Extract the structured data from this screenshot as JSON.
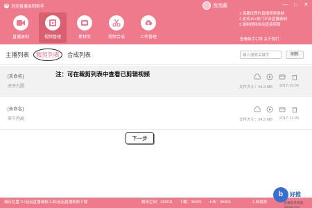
{
  "app": {
    "title": "泡泡直播录制助手",
    "logo_glyph": "B",
    "brand_color": "#ee7a8c"
  },
  "user": {
    "name": "泡泡酱"
  },
  "window_controls": [
    "—",
    "□",
    "✕"
  ],
  "toolbar": [
    {
      "label": "直播录制",
      "icon": "video-camera-icon"
    },
    {
      "label": "视频管理",
      "icon": "film-icon",
      "active": true
    },
    {
      "label": "素材库",
      "icon": "library-icon"
    },
    {
      "label": "视频合成",
      "icon": "scissors-icon"
    },
    {
      "label": "上传管理",
      "icon": "upload-icon"
    }
  ],
  "tips": [
    "1.海量优质的直播视频录制",
    "2.支持15+热门平台直播录制",
    "3.录制视频自动直接剪辑"
  ],
  "help": {
    "guide": "查看新手引导",
    "about": "关于我们"
  },
  "subtabs": [
    "主播列表",
    "裁剪列表",
    "合成列表"
  ],
  "search": {
    "placeholder": "输入搜索关键字",
    "button": "刷新"
  },
  "rows": [
    {
      "name": "[未命名]",
      "sub": "虎牙九圆",
      "size": "文件大小：54.3 MB",
      "date": "2017-12-05"
    },
    {
      "name": "[未命名]",
      "sub": "某牛狗高",
      "size": "文件大小：94.5 MB",
      "date": "2017-12-05"
    }
  ],
  "annotation": "注：可在裁剪列表中查看已剪辑视频",
  "next_button": "下一步",
  "status": {
    "path": "储存位置 D:\\泡泡直播录制工具\\泡泡直播视频下载",
    "free": "剩余空间：289GB",
    "down": "下载：0KB/S",
    "up": "上传：0KB/S",
    "tools": "工具视频"
  },
  "watermark": {
    "text": "好推",
    "sub": "好推软件商城 haotui.com"
  }
}
